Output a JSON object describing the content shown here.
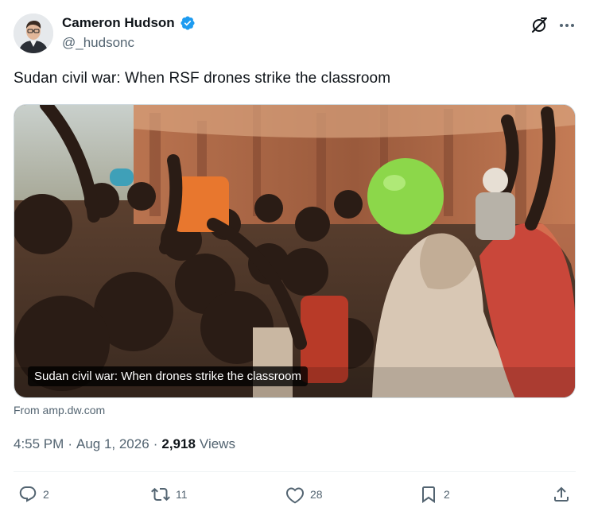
{
  "author": {
    "name": "Cameron Hudson",
    "handle": "@_hudsonc",
    "verified": true,
    "verified_color": "#1d9bf0"
  },
  "header_icons": [
    "grok-icon",
    "more-icon"
  ],
  "tweet": {
    "text": "Sudan civil war: When RSF drones strike the classroom"
  },
  "link_card": {
    "caption": "Sudan civil war: When drones strike the classroom",
    "source": "From amp.dw.com"
  },
  "meta": {
    "time": "4:55 PM",
    "separator": "·",
    "date": "Aug 1, 2026",
    "views_count": "2,918",
    "views_label": "Views"
  },
  "actions": {
    "reply": {
      "icon": "reply-icon",
      "count": "2"
    },
    "retweet": {
      "icon": "retweet-icon",
      "count": "11"
    },
    "like": {
      "icon": "heart-icon",
      "count": "28"
    },
    "bookmark": {
      "icon": "bookmark-icon",
      "count": "2"
    },
    "share": {
      "icon": "share-icon"
    }
  },
  "colors": {
    "text_primary": "#0f1419",
    "text_secondary": "#536471",
    "border": "#cfd9de"
  }
}
